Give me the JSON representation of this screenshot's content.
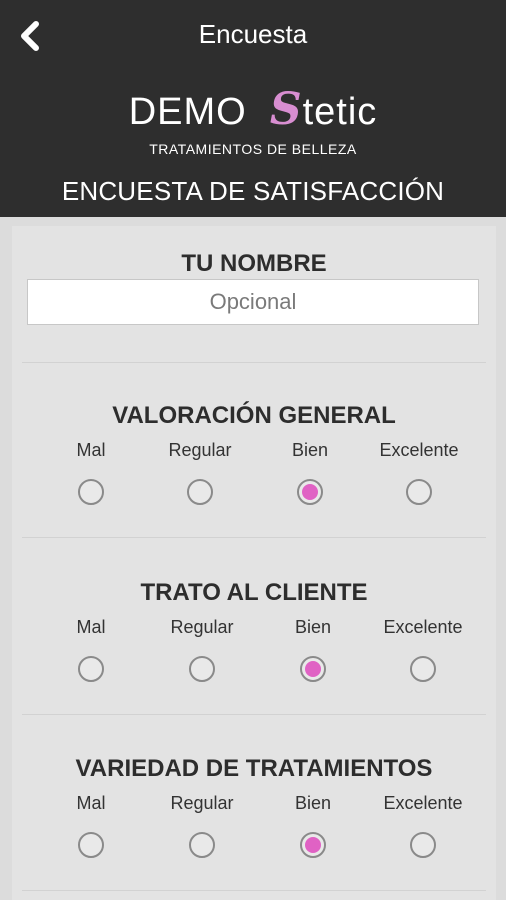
{
  "header": {
    "title": "Encuesta",
    "logo_main": "DEMO",
    "logo_accent_letter": "S",
    "logo_rest": "tetic",
    "tagline": "TRATAMIENTOS DE BELLEZA",
    "subtitle": "ENCUESTA DE SATISFACCIÓN",
    "accent_color": "#d88ed1",
    "back_icon": "chevron-left-icon"
  },
  "name_section": {
    "title": "TU NOMBRE",
    "placeholder": "Opcional",
    "value": ""
  },
  "ratings": [
    {
      "title": "VALORACIÓN GENERAL",
      "options": [
        "Mal",
        "Regular",
        "Bien",
        "Excelente"
      ],
      "selected": "Bien"
    },
    {
      "title": "TRATO AL CLIENTE",
      "options": [
        "Mal",
        "Regular",
        "Bien",
        "Excelente"
      ],
      "selected": "Bien"
    },
    {
      "title": "VARIEDAD DE TRATAMIENTOS",
      "options": [
        "Mal",
        "Regular",
        "Bien",
        "Excelente"
      ],
      "selected": "Bien"
    }
  ],
  "colors": {
    "header_bg": "#2e2e2e",
    "page_bg": "#dcdcdc",
    "radio_selected": "#e062c4"
  }
}
